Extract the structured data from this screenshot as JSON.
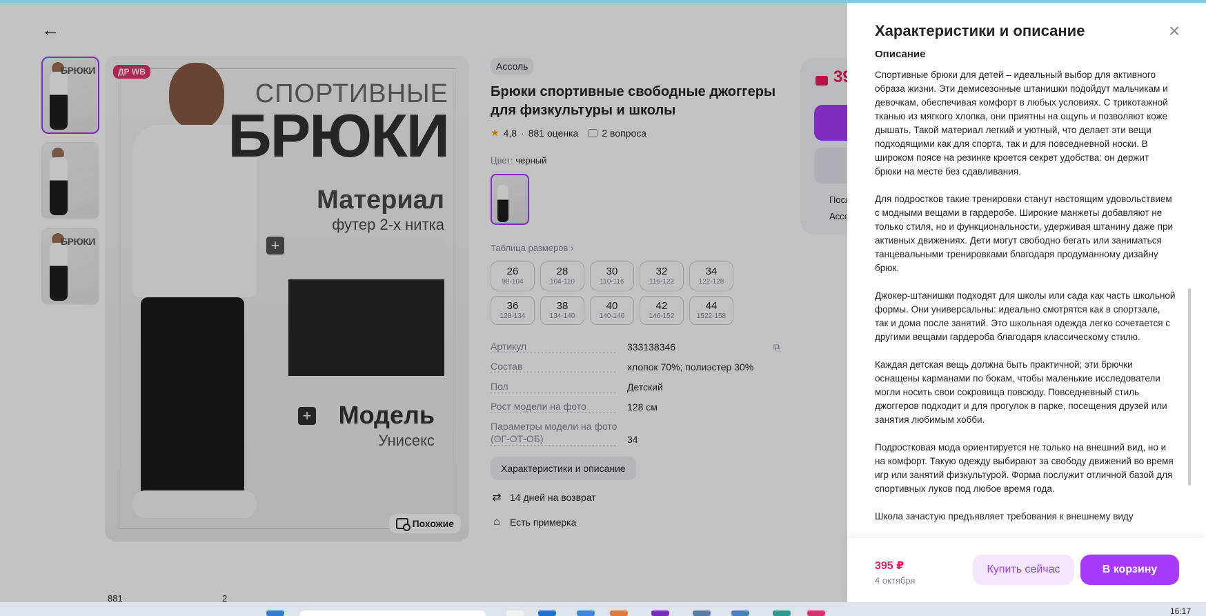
{
  "product": {
    "badge": "ДР WB",
    "image_texts": {
      "sport": "СПОРТИВНЫЕ",
      "bruki": "БРЮКИ",
      "material": "Материал",
      "material_sub": "футер 2-х нитка",
      "model": "Модель",
      "model_sub": "Унисекс"
    },
    "similar_label": "Похожие",
    "brand": "Ассоль",
    "title": "Брюки спортивные свободные джоггеры для физкультуры и школы",
    "rating": "4,8",
    "reviews": "881 оценка",
    "questions": "2 вопроса",
    "color_label": "Цвет:",
    "color_value": "черный",
    "sizes_link": "Таблица размеров ›",
    "sizes": [
      {
        "n": "26",
        "r": "98-104"
      },
      {
        "n": "28",
        "r": "104-110"
      },
      {
        "n": "30",
        "r": "110-116"
      },
      {
        "n": "32",
        "r": "116-122"
      },
      {
        "n": "34",
        "r": "122-128"
      },
      {
        "n": "36",
        "r": "128-134"
      },
      {
        "n": "38",
        "r": "134-140"
      },
      {
        "n": "40",
        "r": "140-146"
      },
      {
        "n": "42",
        "r": "146-152"
      },
      {
        "n": "44",
        "r": "1522-158"
      }
    ],
    "params": [
      {
        "k": "Артикул",
        "v": "333138346"
      },
      {
        "k": "Состав",
        "v": "хлопок 70%; полиэстер 30%"
      },
      {
        "k": "Пол",
        "v": "Детский"
      },
      {
        "k": "Рост модели на фото",
        "v": "128 см"
      },
      {
        "k": "Параметры модели на фото (ОГ-ОТ-ОБ)",
        "v": "34"
      }
    ],
    "desc_button": "Характеристики и описание",
    "features": [
      "14 дней на возврат",
      "Есть примерка"
    ]
  },
  "side_card": {
    "price_partial": "39",
    "line1": "Посл",
    "line2": "Ассо"
  },
  "bottom_tabs": {
    "count1": "881",
    "count2": "2"
  },
  "drawer": {
    "title": "Характеристики и описание",
    "section_title": "Описание",
    "paragraphs": [
      "Спортивные брюки для детей – идеальный выбор для активного образа жизни. Эти демисезонные штанишки подойдут мальчикам и девочкам, обеспечивая комфорт в любых условиях. С трикотажной тканью из мягкого хлопка, они приятны на ощупь и позволяют коже дышать. Такой материал легкий и уютный, что делает эти вещи подходящими как для спорта, так и для повседневной носки. В широком поясе на резинке кроется секрет удобства: он держит брюки на месте без сдавливания.",
      "Для подростков такие тренировки станут настоящим удовольствием с модными вещами в гардеробе. Широкие манжеты добавляют не только стиля, но и функциональности, удерживая штанину даже при активных движениях. Дети могут свободно бегать или заниматься танцевальными тренировками благодаря продуманному дизайну брюк.",
      "Джокер-штанишки подходят для школы или сада как часть школьной формы. Они универсальны: идеально смотрятся как в спортзале, так и дома после занятий. Это школьная одежда легко сочетается с другими вещами гардероба благодаря классическому стилю.",
      "Каждая детская вещь должна быть практичной; эти брючки оснащены карманами по бокам, чтобы маленькие исследователи могли носить свои сокровища повсюду. Повседневный стиль джоггеров подходит и для прогулок в парке, посещения друзей или занятия любимым хобби.",
      "Подростковая мода ориентируется не только на внешний вид, но и на комфорт. Такую одежду выбирают за свободу движений во время игр или занятий физкультурой. Форма послужит отличной базой для спортивных луков под любое время года.",
      "Школа зачастую предъявляет требования к внешнему виду"
    ],
    "price": "395 ₽",
    "delivery_date": "4 октября",
    "buy_now": "Купить сейчас",
    "to_cart": "В корзину"
  },
  "taskbar": {
    "time": "16:17"
  },
  "colors": {
    "accent": "#a73afd",
    "price": "#f0185b",
    "badge": "#e3346d"
  }
}
